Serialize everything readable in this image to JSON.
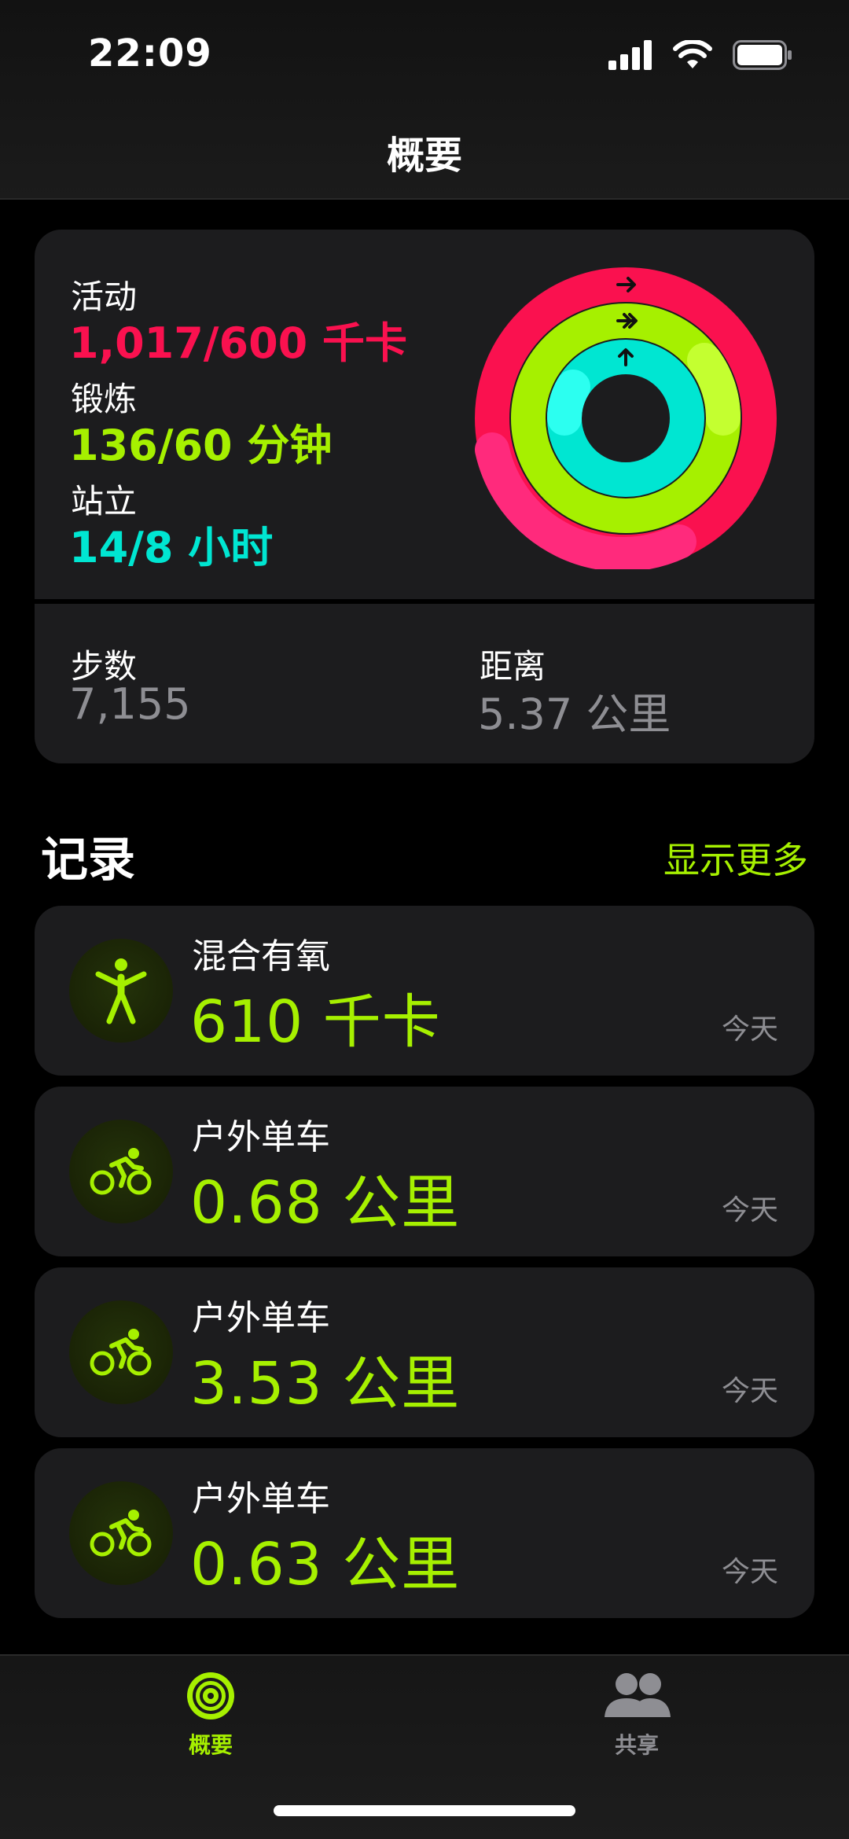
{
  "status_bar": {
    "time": "22:09"
  },
  "nav": {
    "title": "概要"
  },
  "summary": {
    "move": {
      "label": "活动",
      "value": "1,017/600 千卡",
      "color": "#fa114f",
      "fraction": 1.695
    },
    "exercise": {
      "label": "锻炼",
      "value": "136/60 分钟",
      "color": "#a6f000",
      "fraction": 2.267
    },
    "stand": {
      "label": "站立",
      "value": "14/8 小时",
      "color": "#00e6d2",
      "fraction": 1.75
    },
    "steps": {
      "label": "步数",
      "value": "7,155"
    },
    "distance": {
      "label": "距离",
      "value": "5.37 公里"
    }
  },
  "records": {
    "title": "记录",
    "show_more": "显示更多",
    "items": [
      {
        "name": "混合有氧",
        "value": "610 千卡",
        "date": "今天",
        "icon": "mixed-cardio-icon"
      },
      {
        "name": "户外单车",
        "value": "0.68 公里",
        "date": "今天",
        "icon": "cycling-icon"
      },
      {
        "name": "户外单车",
        "value": "3.53 公里",
        "date": "今天",
        "icon": "cycling-icon"
      },
      {
        "name": "户外单车",
        "value": "0.63 公里",
        "date": "今天",
        "icon": "cycling-icon"
      }
    ]
  },
  "tabs": [
    {
      "label": "概要",
      "active": true,
      "icon": "activity-rings-icon"
    },
    {
      "label": "共享",
      "active": false,
      "icon": "sharing-people-icon"
    }
  ],
  "colors": {
    "accent": "#a6f000",
    "background": "#000000",
    "card": "#1c1c1e",
    "secondary_text": "#8e8e93"
  }
}
